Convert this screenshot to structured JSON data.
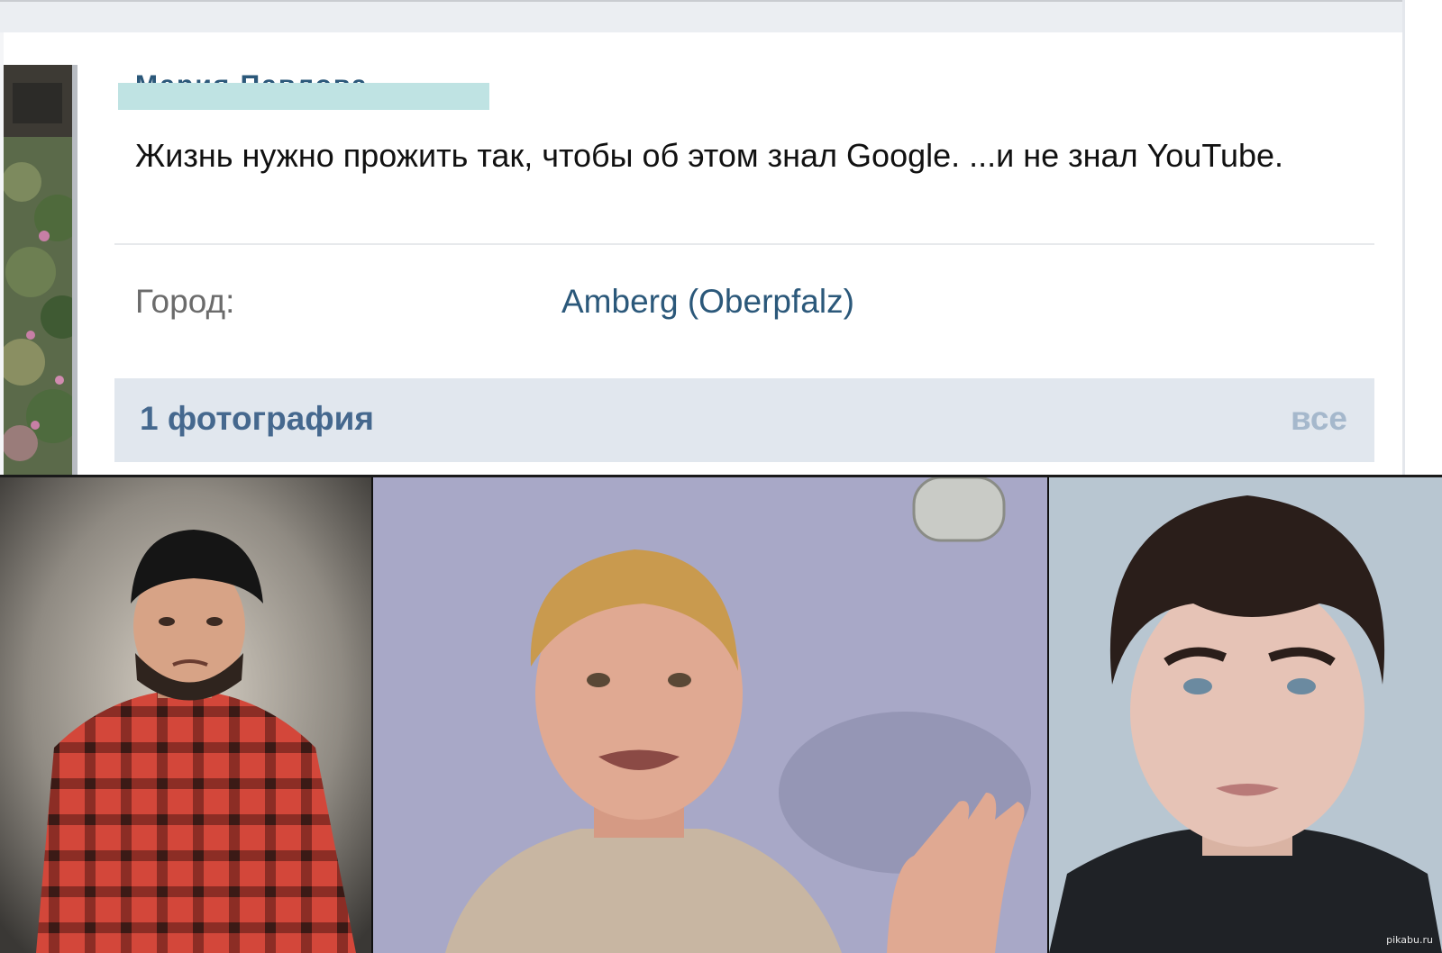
{
  "profile": {
    "name": "Мария Павлова",
    "status": "Жизнь нужно прожить так, чтобы об этом знал Google. ...и не знал YouTube.",
    "info": {
      "label": "Город:",
      "value": "Amberg (Oberpfalz)"
    }
  },
  "photos_section": {
    "title": "1 фотография",
    "all_link": "все"
  },
  "colors": {
    "link": "#2b587a",
    "section_bg": "#e1e7ee",
    "redaction": "#bfe3e3"
  },
  "watermark": "pikabu.ru"
}
